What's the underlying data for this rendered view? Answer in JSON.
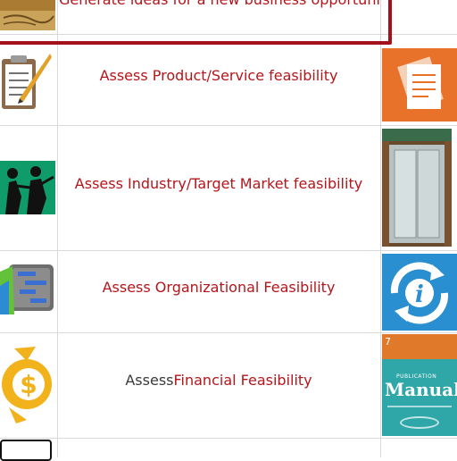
{
  "rows": [
    {
      "label": "Generate ideas for a new business opportunity"
    },
    {
      "label": "Assess Product/Service feasibility"
    },
    {
      "label": "Assess Industry/Target Market feasibility"
    },
    {
      "label": "Assess Organizational Feasibility"
    },
    {
      "label_plain": "Assess ",
      "label_accent": "Financial Feasibility"
    }
  ],
  "book_cover": {
    "title": "Manual",
    "overline": "PUBLICATION",
    "number": "7"
  },
  "colors": {
    "accent_red": "#b4161b",
    "highlight_border": "#a3111a",
    "documents_tile": "#e9722a",
    "refresh_tile": "#2a8fd0",
    "book_tile": "#2fa6a8",
    "coin": "#f2b21b"
  },
  "icons": [
    "clipboard-icon",
    "documents-icon",
    "silhouette-scene-icon",
    "elevator-photo-icon",
    "gantt-chart-icon",
    "refresh-info-icon",
    "dollar-coin-icon",
    "book-cover-icon"
  ]
}
